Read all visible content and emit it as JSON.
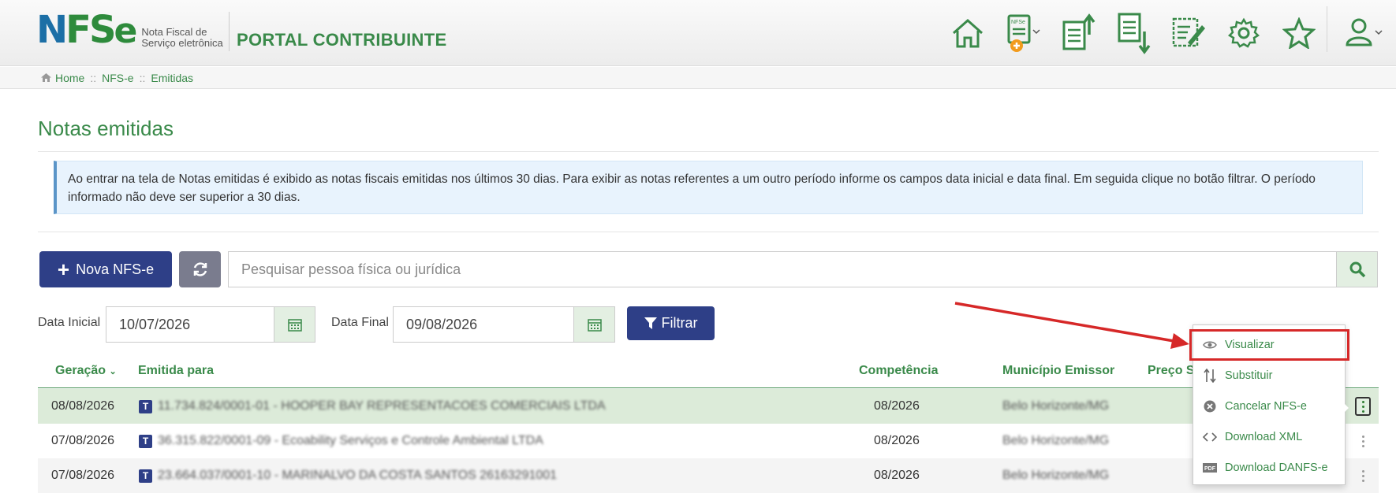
{
  "header": {
    "logo_text_n": "N",
    "logo_text_fs": "FS",
    "logo_text_e": "e",
    "logo_sub_1": "Nota Fiscal de",
    "logo_sub_2": "Serviço eletrônica",
    "portal_title": "PORTAL CONTRIBUINTE",
    "icons": [
      "home-icon",
      "new-nfse-icon",
      "upload-document-icon",
      "download-document-icon",
      "sign-document-icon",
      "gear-icon",
      "star-icon",
      "user-icon"
    ],
    "new_nfse_icon_label": "NFSe",
    "accent_color": "#3a8a4a",
    "primary_color": "#2e3f87"
  },
  "breadcrumb": {
    "items": [
      "Home",
      "NFS-e",
      "Emitidas"
    ],
    "separator": "::"
  },
  "page": {
    "title": "Notas emitidas",
    "info": "Ao entrar na tela de Notas emitidas é exibido as notas fiscais emitidas nos últimos 30 dias. Para exibir as notas referentes a um outro período informe os campos data inicial e data final. Em seguida clique no botão filtrar. O período informado não deve ser superior a 30 dias."
  },
  "toolbar": {
    "new_button": "Nova NFS-e",
    "search_placeholder": "Pesquisar pessoa física ou jurídica"
  },
  "filters": {
    "start_label": "Data Inicial",
    "start_value": "10/07/2026",
    "end_label": "Data Final",
    "end_value": "09/08/2026",
    "filter_button": "Filtrar"
  },
  "table": {
    "columns": [
      "Geração",
      "Emitida para",
      "Competência",
      "Município Emissor",
      "Preço S"
    ],
    "rows": [
      {
        "geracao": "08/08/2026",
        "tipo": "T",
        "emitida_para": "11.734.824/0001-01 - HOOPER BAY REPRESENTACOES COMERCIAIS LTDA",
        "competencia": "08/2026",
        "municipio": "Belo Horizonte/MG"
      },
      {
        "geracao": "07/08/2026",
        "tipo": "T",
        "emitida_para": "36.315.822/0001-09 - Ecoability Serviços e Controle Ambiental LTDA",
        "competencia": "08/2026",
        "municipio": "Belo Horizonte/MG"
      },
      {
        "geracao": "07/08/2026",
        "tipo": "T",
        "emitida_para": "23.664.037/0001-10 - MARINALVO DA COSTA SANTOS 26163291001",
        "competencia": "08/2026",
        "municipio": "Belo Horizonte/MG"
      }
    ]
  },
  "menu": {
    "items": [
      {
        "label": "Visualizar",
        "icon": "eye-icon"
      },
      {
        "label": "Substituir",
        "icon": "swap-icon"
      },
      {
        "label": "Cancelar NFS-e",
        "icon": "cancel-icon"
      },
      {
        "label": "Download XML",
        "icon": "code-icon"
      },
      {
        "label": "Download DANFS-e",
        "icon": "pdf-icon"
      }
    ],
    "pdf_icon_label": "PDF",
    "highlight_color": "#d62828"
  }
}
